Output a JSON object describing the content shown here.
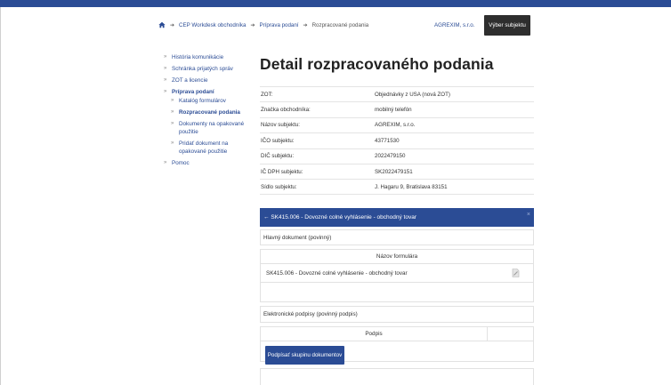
{
  "breadcrumb": {
    "items": [
      "CEP Workdesk obchodníka",
      "Príprava podaní"
    ],
    "current": "Rozpracované podania"
  },
  "header": {
    "organization": "AGREXIM, s.r.o.",
    "select_subject": "Výber subjektu"
  },
  "sidebar": {
    "items": [
      {
        "label": "História komunikácie"
      },
      {
        "label": "Schránka prijatých správ"
      },
      {
        "label": "ZOT a licencie"
      },
      {
        "label": "Príprava podaní"
      },
      {
        "label": "Pomoc"
      }
    ],
    "subitems": [
      {
        "label": "Katalóg formulárov"
      },
      {
        "label": "Rozpracované podania"
      },
      {
        "label": "Dokumenty na opakované použitie"
      },
      {
        "label": "Pridať dokument na opakované použitie"
      }
    ]
  },
  "page_title": "Detail rozpracovaného podania",
  "details": [
    {
      "key": "ZOT:",
      "value": "Objednávky z USA (nová ZOT)"
    },
    {
      "key": "Značka obchodníka:",
      "value": "mobilný telefón"
    },
    {
      "key": "Názov subjektu:",
      "value": "AGREXIM, s.r.o."
    },
    {
      "key": "IČO subjektu:",
      "value": "43771530"
    },
    {
      "key": "DIČ subjektu:",
      "value": "2022479150"
    },
    {
      "key": "IČ DPH subjektu:",
      "value": "SK2022479151"
    },
    {
      "key": "Sídlo subjektu:",
      "value": "J. Hagaru 9, Bratislava 83151"
    }
  ],
  "panel": {
    "title": "SK415.006 - Dovozné colné vyhlásenie - obchodný tovar",
    "close": "×"
  },
  "main_document": {
    "label": "Hlavný dokument (povinný)",
    "column": "Názov formulára",
    "rows": [
      "SK415.006 - Dovozné colné vyhlásenie - obchodný tovar"
    ]
  },
  "signatures": {
    "label": "Elektronické podpisy (povinný podpis)",
    "column": "Podpis",
    "sign_button": "Podpísať skupinu dokumentov"
  },
  "colors": {
    "primary": "#2b4c95",
    "dark_button": "#2e2e2e"
  }
}
